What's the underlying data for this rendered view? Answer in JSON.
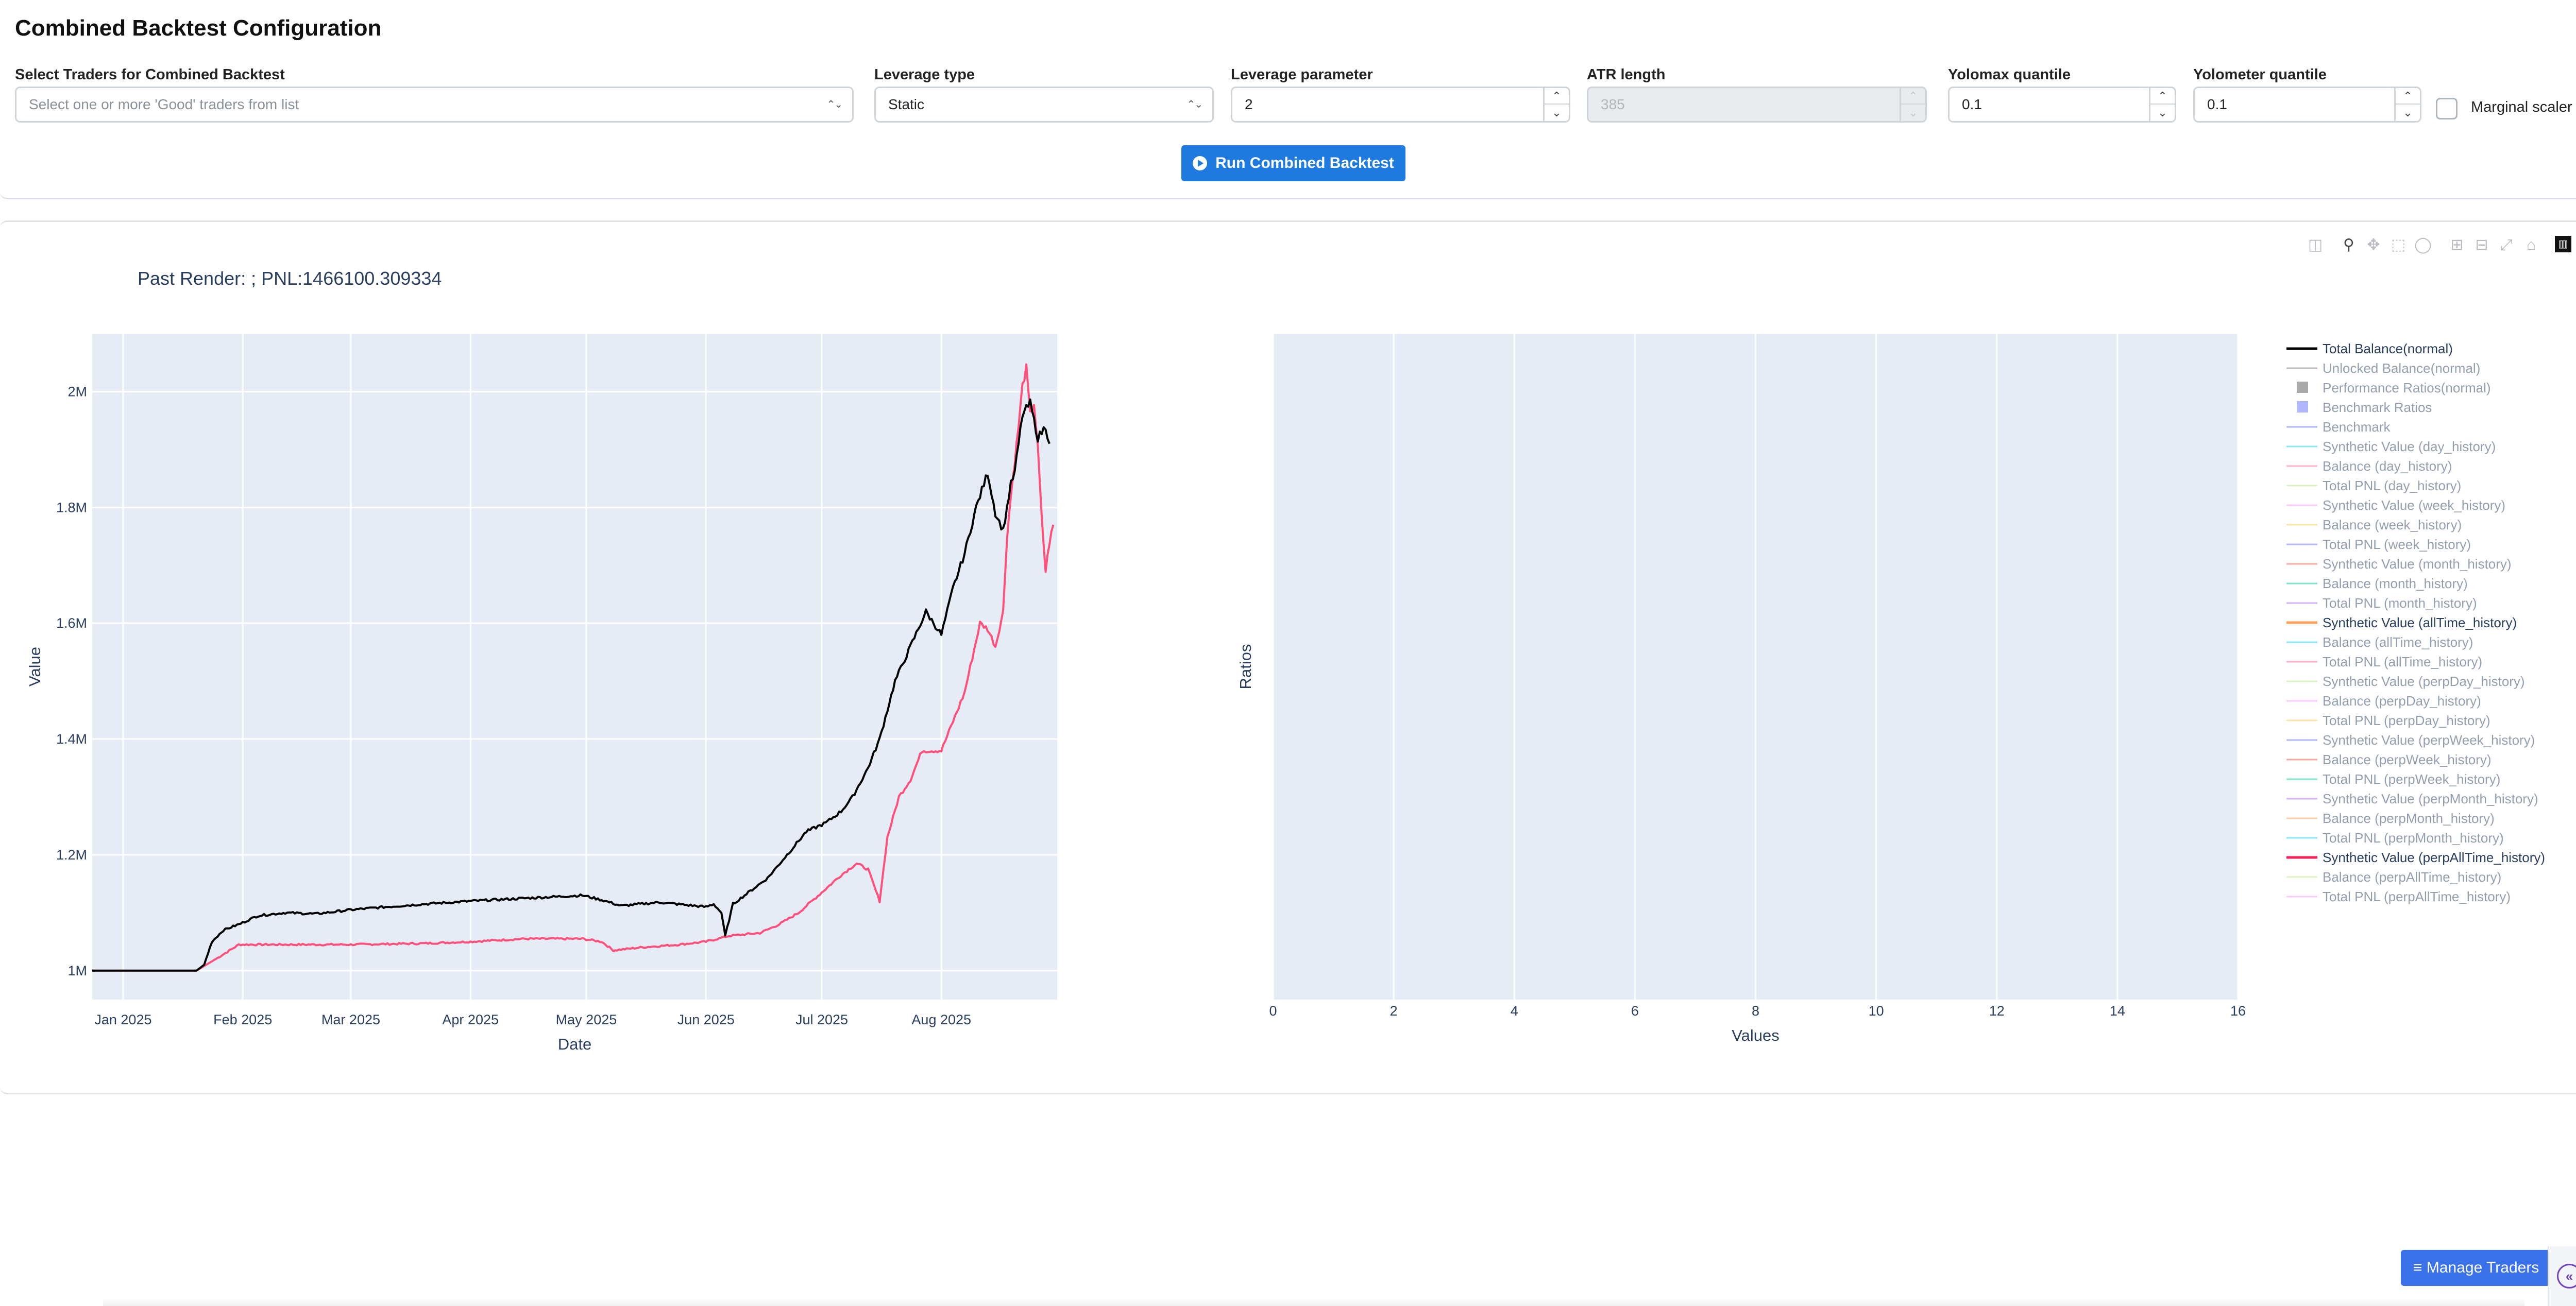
{
  "page": {
    "title": "Combined Backtest Configuration"
  },
  "form": {
    "traders": {
      "label": "Select Traders for Combined Backtest",
      "placeholder": "Select one or more 'Good' traders from list"
    },
    "leverage_type": {
      "label": "Leverage type",
      "value": "Static"
    },
    "leverage_parameter": {
      "label": "Leverage parameter",
      "value": "2"
    },
    "atr_length": {
      "label": "ATR length",
      "value": "385",
      "disabled": true
    },
    "yolomax_quantile": {
      "label": "Yolomax quantile",
      "value": "0.1"
    },
    "yolometer_quantile": {
      "label": "Yolometer quantile",
      "value": "0.1"
    },
    "marginal_scaler": {
      "label": "Marginal scaler",
      "checked": false
    },
    "run_button": "Run Combined Backtest"
  },
  "toolbar": {
    "icons": [
      "camera-icon",
      "zoom-icon",
      "pan-icon",
      "box-select-icon",
      "lasso-select-icon",
      "zoom-in-icon",
      "zoom-out-icon",
      "autoscale-icon",
      "reset-axes-icon",
      "plotly-logo-icon"
    ]
  },
  "plot_title": "Past Render: ; PNL:1466100.309334",
  "legend": [
    {
      "label": "Total Balance(normal)",
      "color": "#000000",
      "kind": "line",
      "active": true
    },
    {
      "label": "Unlocked Balance(normal)",
      "color": "#7f7f7f",
      "kind": "line",
      "active": false
    },
    {
      "label": "Performance Ratios(normal)",
      "color": "#555555",
      "kind": "box",
      "active": false
    },
    {
      "label": "Benchmark Ratios",
      "color": "#636efa",
      "kind": "box",
      "active": false
    },
    {
      "label": "Benchmark",
      "color": "#636efa",
      "kind": "line",
      "active": false
    },
    {
      "label": "Synthetic Value (day_history)",
      "color": "#19d3f3",
      "kind": "line",
      "active": false
    },
    {
      "label": "Balance (day_history)",
      "color": "#ff6692",
      "kind": "line",
      "active": false
    },
    {
      "label": "Total PNL (day_history)",
      "color": "#b6e880",
      "kind": "line",
      "active": false
    },
    {
      "label": "Synthetic Value (week_history)",
      "color": "#ff97ff",
      "kind": "line",
      "active": false
    },
    {
      "label": "Balance (week_history)",
      "color": "#fecb52",
      "kind": "line",
      "active": false
    },
    {
      "label": "Total PNL (week_history)",
      "color": "#636efa",
      "kind": "line",
      "active": false
    },
    {
      "label": "Synthetic Value (month_history)",
      "color": "#ef553b",
      "kind": "line",
      "active": false
    },
    {
      "label": "Balance (month_history)",
      "color": "#00cc96",
      "kind": "line",
      "active": false
    },
    {
      "label": "Total PNL (month_history)",
      "color": "#ab63fa",
      "kind": "line",
      "active": false
    },
    {
      "label": "Synthetic Value (allTime_history)",
      "color": "#ffa15a",
      "kind": "line",
      "active": true
    },
    {
      "label": "Balance (allTime_history)",
      "color": "#19d3f3",
      "kind": "line",
      "active": false
    },
    {
      "label": "Total PNL (allTime_history)",
      "color": "#ff6692",
      "kind": "line",
      "active": false
    },
    {
      "label": "Synthetic Value (perpDay_history)",
      "color": "#b6e880",
      "kind": "line",
      "active": false
    },
    {
      "label": "Balance (perpDay_history)",
      "color": "#ff97ff",
      "kind": "line",
      "active": false
    },
    {
      "label": "Total PNL (perpDay_history)",
      "color": "#fecb52",
      "kind": "line",
      "active": false
    },
    {
      "label": "Synthetic Value (perpWeek_history)",
      "color": "#636efa",
      "kind": "line",
      "active": false
    },
    {
      "label": "Balance (perpWeek_history)",
      "color": "#ef553b",
      "kind": "line",
      "active": false
    },
    {
      "label": "Total PNL (perpWeek_history)",
      "color": "#00cc96",
      "kind": "line",
      "active": false
    },
    {
      "label": "Synthetic Value (perpMonth_history)",
      "color": "#ab63fa",
      "kind": "line",
      "active": false
    },
    {
      "label": "Balance (perpMonth_history)",
      "color": "#ffa15a",
      "kind": "line",
      "active": false
    },
    {
      "label": "Total PNL (perpMonth_history)",
      "color": "#19d3f3",
      "kind": "line",
      "active": false
    },
    {
      "label": "Synthetic Value (perpAllTime_history)",
      "color": "#ff1f5b",
      "kind": "line",
      "active": true
    },
    {
      "label": "Balance (perpAllTime_history)",
      "color": "#b6e880",
      "kind": "line",
      "active": false
    },
    {
      "label": "Total PNL (perpAllTime_history)",
      "color": "#ff97ff",
      "kind": "line",
      "active": false
    }
  ],
  "chart_data": [
    {
      "type": "line",
      "xlabel": "Date",
      "ylabel": "Value",
      "x_range": [
        "2024-12-24",
        "2025-08-31"
      ],
      "ylim": [
        950000,
        2100000
      ],
      "x_ticks": [
        {
          "label": "Jan 2025",
          "date": "2025-01-01"
        },
        {
          "label": "Feb 2025",
          "date": "2025-02-01"
        },
        {
          "label": "Mar 2025",
          "date": "2025-03-01"
        },
        {
          "label": "Apr 2025",
          "date": "2025-04-01"
        },
        {
          "label": "May 2025",
          "date": "2025-05-01"
        },
        {
          "label": "Jun 2025",
          "date": "2025-06-01"
        },
        {
          "label": "Jul 2025",
          "date": "2025-07-01"
        },
        {
          "label": "Aug 2025",
          "date": "2025-08-01"
        }
      ],
      "y_ticks": [
        {
          "label": "1M",
          "value": 1000000
        },
        {
          "label": "1.2M",
          "value": 1200000
        },
        {
          "label": "1.4M",
          "value": 1400000
        },
        {
          "label": "1.6M",
          "value": 1600000
        },
        {
          "label": "1.8M",
          "value": 1800000
        },
        {
          "label": "2M",
          "value": 2000000
        }
      ],
      "grid": true,
      "series": [
        {
          "name": "Total Balance(normal)",
          "color": "#000000",
          "points": [
            [
              "2024-12-24",
              1000000
            ],
            [
              "2025-01-10",
              1000000
            ],
            [
              "2025-01-20",
              1000000
            ],
            [
              "2025-01-22",
              1010000
            ],
            [
              "2025-01-24",
              1050000
            ],
            [
              "2025-01-27",
              1070000
            ],
            [
              "2025-01-31",
              1080000
            ],
            [
              "2025-02-05",
              1095000
            ],
            [
              "2025-02-12",
              1100000
            ],
            [
              "2025-02-20",
              1098000
            ],
            [
              "2025-03-01",
              1105000
            ],
            [
              "2025-03-10",
              1110000
            ],
            [
              "2025-03-20",
              1115000
            ],
            [
              "2025-04-01",
              1120000
            ],
            [
              "2025-04-15",
              1125000
            ],
            [
              "2025-04-30",
              1130000
            ],
            [
              "2025-05-05",
              1122000
            ],
            [
              "2025-05-10",
              1112000
            ],
            [
              "2025-05-20",
              1118000
            ],
            [
              "2025-06-01",
              1110000
            ],
            [
              "2025-06-03",
              1115000
            ],
            [
              "2025-06-05",
              1100000
            ],
            [
              "2025-06-06",
              1060000
            ],
            [
              "2025-06-08",
              1115000
            ],
            [
              "2025-06-12",
              1135000
            ],
            [
              "2025-06-17",
              1160000
            ],
            [
              "2025-06-22",
              1200000
            ],
            [
              "2025-06-27",
              1240000
            ],
            [
              "2025-07-02",
              1255000
            ],
            [
              "2025-07-06",
              1275000
            ],
            [
              "2025-07-09",
              1300000
            ],
            [
              "2025-07-13",
              1350000
            ],
            [
              "2025-07-16",
              1400000
            ],
            [
              "2025-07-20",
              1500000
            ],
            [
              "2025-07-24",
              1560000
            ],
            [
              "2025-07-28",
              1620000
            ],
            [
              "2025-08-01",
              1580000
            ],
            [
              "2025-08-04",
              1660000
            ],
            [
              "2025-08-07",
              1720000
            ],
            [
              "2025-08-10",
              1800000
            ],
            [
              "2025-08-13",
              1860000
            ],
            [
              "2025-08-15",
              1790000
            ],
            [
              "2025-08-17",
              1760000
            ],
            [
              "2025-08-19",
              1840000
            ],
            [
              "2025-08-20",
              1860000
            ],
            [
              "2025-08-22",
              1960000
            ],
            [
              "2025-08-24",
              1980000
            ],
            [
              "2025-08-26",
              1920000
            ],
            [
              "2025-08-28",
              1940000
            ],
            [
              "2025-08-29",
              1910000
            ]
          ]
        },
        {
          "name": "Synthetic Value (perpAllTime_history)",
          "color": "#ff4f7b",
          "points": [
            [
              "2024-12-24",
              1000000
            ],
            [
              "2025-01-20",
              1000000
            ],
            [
              "2025-01-25",
              1020000
            ],
            [
              "2025-01-31",
              1045000
            ],
            [
              "2025-02-15",
              1045000
            ],
            [
              "2025-03-01",
              1045000
            ],
            [
              "2025-03-20",
              1047000
            ],
            [
              "2025-04-01",
              1050000
            ],
            [
              "2025-04-15",
              1055000
            ],
            [
              "2025-04-30",
              1055000
            ],
            [
              "2025-05-05",
              1050000
            ],
            [
              "2025-05-08",
              1035000
            ],
            [
              "2025-05-15",
              1040000
            ],
            [
              "2025-05-25",
              1045000
            ],
            [
              "2025-06-01",
              1050000
            ],
            [
              "2025-06-07",
              1060000
            ],
            [
              "2025-06-15",
              1065000
            ],
            [
              "2025-06-20",
              1080000
            ],
            [
              "2025-06-25",
              1100000
            ],
            [
              "2025-07-01",
              1135000
            ],
            [
              "2025-07-06",
              1165000
            ],
            [
              "2025-07-10",
              1185000
            ],
            [
              "2025-07-13",
              1175000
            ],
            [
              "2025-07-16",
              1120000
            ],
            [
              "2025-07-18",
              1230000
            ],
            [
              "2025-07-21",
              1300000
            ],
            [
              "2025-07-24",
              1330000
            ],
            [
              "2025-07-27",
              1380000
            ],
            [
              "2025-08-01",
              1380000
            ],
            [
              "2025-08-04",
              1430000
            ],
            [
              "2025-08-07",
              1480000
            ],
            [
              "2025-08-09",
              1540000
            ],
            [
              "2025-08-11",
              1600000
            ],
            [
              "2025-08-13",
              1590000
            ],
            [
              "2025-08-15",
              1560000
            ],
            [
              "2025-08-17",
              1620000
            ],
            [
              "2025-08-18",
              1750000
            ],
            [
              "2025-08-19",
              1820000
            ],
            [
              "2025-08-21",
              1940000
            ],
            [
              "2025-08-22",
              2010000
            ],
            [
              "2025-08-23",
              2040000
            ],
            [
              "2025-08-24",
              1960000
            ],
            [
              "2025-08-25",
              1980000
            ],
            [
              "2025-08-26",
              1900000
            ],
            [
              "2025-08-27",
              1780000
            ],
            [
              "2025-08-28",
              1690000
            ],
            [
              "2025-08-29",
              1740000
            ],
            [
              "2025-08-30",
              1770000
            ]
          ]
        }
      ]
    },
    {
      "type": "bar",
      "xlabel": "Values",
      "ylabel": "Ratios",
      "xlim": [
        0,
        16
      ],
      "x_ticks": [
        {
          "label": "0",
          "value": 0
        },
        {
          "label": "2",
          "value": 2
        },
        {
          "label": "4",
          "value": 4
        },
        {
          "label": "6",
          "value": 6
        },
        {
          "label": "8",
          "value": 8
        },
        {
          "label": "10",
          "value": 10
        },
        {
          "label": "12",
          "value": 12
        },
        {
          "label": "14",
          "value": 14
        },
        {
          "label": "16",
          "value": 16
        }
      ],
      "grid": true,
      "series": []
    }
  ],
  "manage_button": "Manage Traders"
}
